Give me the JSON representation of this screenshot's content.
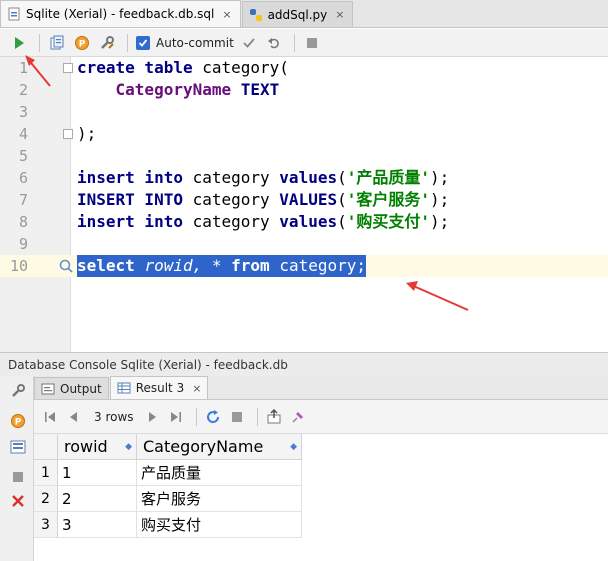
{
  "tabs": [
    {
      "label": "Sqlite (Xerial) - feedback.db.sql",
      "close": "×"
    },
    {
      "label": "addSql.py",
      "close": "×"
    }
  ],
  "toolbar": {
    "autocommit_label": "Auto-commit"
  },
  "editor": {
    "lines": [
      {
        "num": "1",
        "code": [
          {
            "t": "create table ",
            "c": "kw"
          },
          {
            "t": "category(",
            "c": ""
          }
        ]
      },
      {
        "num": "2",
        "code": [
          {
            "t": "    ",
            "c": ""
          },
          {
            "t": "CategoryName",
            "c": "field"
          },
          {
            "t": " ",
            "c": ""
          },
          {
            "t": "TEXT",
            "c": "kw"
          }
        ]
      },
      {
        "num": "3",
        "code": []
      },
      {
        "num": "4",
        "code": [
          {
            "t": ");",
            "c": ""
          }
        ]
      },
      {
        "num": "5",
        "code": []
      },
      {
        "num": "6",
        "code": [
          {
            "t": "insert into ",
            "c": "kw"
          },
          {
            "t": "category ",
            "c": ""
          },
          {
            "t": "values",
            "c": "kw"
          },
          {
            "t": "(",
            "c": ""
          },
          {
            "t": "'产品质量'",
            "c": "str"
          },
          {
            "t": ");",
            "c": ""
          }
        ]
      },
      {
        "num": "7",
        "code": [
          {
            "t": "INSERT INTO ",
            "c": "kw"
          },
          {
            "t": "category ",
            "c": ""
          },
          {
            "t": "VALUES",
            "c": "kw"
          },
          {
            "t": "(",
            "c": ""
          },
          {
            "t": "'客户服务'",
            "c": "str"
          },
          {
            "t": ");",
            "c": ""
          }
        ]
      },
      {
        "num": "8",
        "code": [
          {
            "t": "insert into ",
            "c": "kw"
          },
          {
            "t": "category ",
            "c": ""
          },
          {
            "t": "values",
            "c": "kw"
          },
          {
            "t": "(",
            "c": ""
          },
          {
            "t": "'购买支付'",
            "c": "str"
          },
          {
            "t": ");",
            "c": ""
          }
        ]
      },
      {
        "num": "9",
        "code": []
      },
      {
        "num": "10",
        "code": [
          {
            "t": "select ",
            "c": "kw"
          },
          {
            "t": "rowid",
            "c": "it"
          },
          {
            "t": ", * ",
            "c": "it"
          },
          {
            "t": "from ",
            "c": "kw"
          },
          {
            "t": "category;",
            "c": ""
          }
        ],
        "selected": true
      }
    ]
  },
  "console": {
    "title": "Database Console Sqlite (Xerial) - feedback.db",
    "tabs": [
      {
        "label": "Output"
      },
      {
        "label": "Result 3",
        "close": "×"
      }
    ],
    "rows_label": "3 rows"
  },
  "grid": {
    "columns": [
      "rowid",
      "CategoryName"
    ],
    "rows": [
      {
        "rn": "1",
        "cells": [
          "1",
          "产品质量"
        ]
      },
      {
        "rn": "2",
        "cells": [
          "2",
          "客户服务"
        ]
      },
      {
        "rn": "3",
        "cells": [
          "3",
          "购买支付"
        ]
      }
    ]
  },
  "colors": {
    "keyword": "#000080",
    "string": "#008000",
    "selection": "#2f65ca",
    "annotation": "#e53935"
  }
}
